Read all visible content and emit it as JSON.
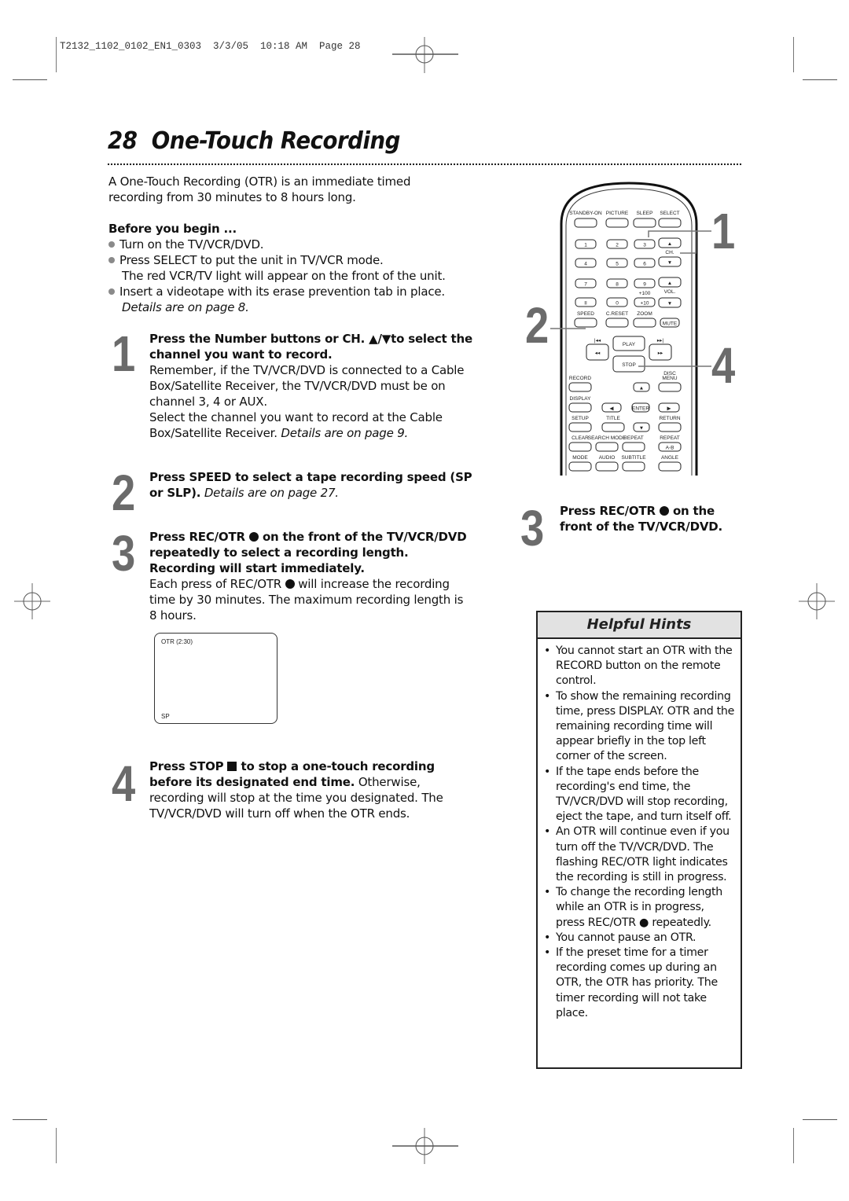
{
  "print_header": {
    "slug": "T2132_1102_0102_EN1_0303  3/3/05  10:18 AM  Page 28"
  },
  "page": {
    "number": "28",
    "title": "One-Touch Recording"
  },
  "intro": {
    "text": "A One-Touch Recording (OTR) is an immediate timed recording from 30 minutes to 8 hours long."
  },
  "before_you_begin": {
    "heading": "Before you begin ...",
    "items": [
      {
        "text": "Turn on the TV/VCR/DVD."
      },
      {
        "text": "Press SELECT to put the unit in TV/VCR mode.",
        "note": "The red VCR/TV light will appear on the front of the unit."
      },
      {
        "text": "Insert a videotape with its erase prevention tab in place.",
        "note": "Details are on page 8."
      }
    ]
  },
  "steps": [
    {
      "number": "1",
      "bold": "Press the Number buttons or CH. ▲/▼to select the channel you want to record.",
      "body": "Remember, if the TV/VCR/DVD is connected to a Cable Box/Satellite Receiver, the TV/VCR/DVD must be on channel 3, 4 or AUX.",
      "body2": "Select the channel you want to record at the Cable Box/Satellite Receiver.",
      "ref": "Details are on page 9."
    },
    {
      "number": "2",
      "bold": "Press SPEED to select a tape recording speed (SP or SLP).",
      "ref": "Details are on page 27."
    },
    {
      "number": "3",
      "bold_a": "Press REC/OTR",
      "bold_b": "on the front of the TV/VCR/DVD repeatedly to select a recording length. Recording will start immediately.",
      "body_a": "Each press of REC/OTR",
      "body_b": "will increase the recording time by 30 minutes. The maximum recording length is 8 hours."
    },
    {
      "number": "4",
      "bold_a": "Press STOP",
      "bold_b": "to stop a one-touch recording before its designated end time.",
      "body": "Otherwise, recording will stop at the time you designated. The TV/VCR/DVD will turn off when the OTR ends."
    }
  ],
  "screen_display": {
    "top_left": "OTR (2:30)",
    "bottom_left": "SP"
  },
  "remote": {
    "callouts": [
      "1",
      "2",
      "4"
    ],
    "top_row": [
      "STANDBY-ON",
      "PICTURE",
      "SLEEP",
      "SELECT"
    ],
    "numbers": [
      "1",
      "2",
      "3",
      "4",
      "5",
      "6",
      "7",
      "8",
      "9",
      "II",
      "0",
      "+10"
    ],
    "plus100": "+100",
    "ch_label": "CH.",
    "vol_label": "VOL.",
    "row_speed": [
      "SPEED",
      "C.RESET",
      "ZOOM"
    ],
    "mute": "MUTE",
    "play": "PLAY",
    "stop": "STOP",
    "record": "RECORD",
    "disc_menu": [
      "DISC",
      "MENU"
    ],
    "display": "DISPLAY",
    "enter": "ENTER",
    "row_setup": [
      "SETUP",
      "TITLE",
      "RETURN"
    ],
    "row_clear": [
      "CLEAR",
      "SEARCH MODE",
      "REPEAT",
      "REPEAT"
    ],
    "ab": "A-B",
    "row_mode": [
      "MODE",
      "AUDIO",
      "SUBTITLE",
      "ANGLE"
    ]
  },
  "side_step": {
    "number": "3",
    "text_a": "Press REC/OTR",
    "text_b": "on the front of the TV/VCR/DVD."
  },
  "helpful_hints": {
    "title": "Helpful Hints",
    "items": [
      "You cannot start an OTR with the RECORD button on the remote control.",
      "To show the remaining recording time, press DISPLAY. OTR and the remaining recording time will appear briefly in the top left corner of the screen.",
      "If the tape ends before the recording's end time, the TV/VCR/DVD will stop recording, eject the tape, and turn itself off.",
      "An OTR will continue even if you turn off the TV/VCR/DVD. The flashing REC/OTR light indicates the recording is still in progress.",
      "To change the recording length while an OTR is in progress, press  REC/OTR ● repeatedly.",
      "You cannot pause an OTR.",
      "If the preset time for a timer recording comes up during an OTR, the OTR has priority. The timer recording will not take place."
    ]
  }
}
